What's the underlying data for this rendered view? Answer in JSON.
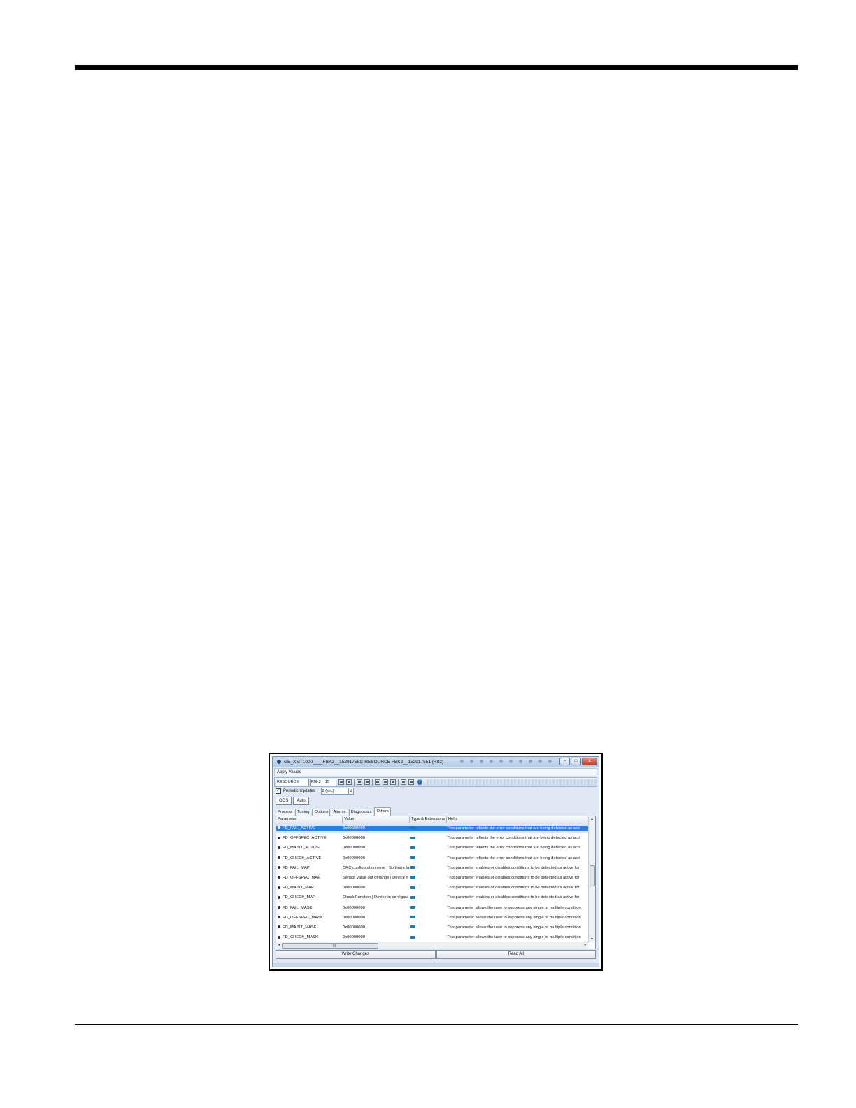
{
  "window": {
    "title": "GE_XMT1000____FBK2__152917551: RESOURCE        FBK2__152917551 (R82)",
    "minimize": "–",
    "maximize": "□",
    "close": "x"
  },
  "menu": {
    "apply_values": "Apply Values"
  },
  "toolbar": {
    "block_name": "RESOURCE",
    "block_tag": "FBK2__15"
  },
  "periodic": {
    "label": "Periodic Updates",
    "checked": "✓",
    "interval": "2 (sec)"
  },
  "modes": [
    "OOS",
    "Auto"
  ],
  "tabs": [
    "Process",
    "Tuning",
    "Options",
    "Alarms",
    "Diagnostics",
    "Others"
  ],
  "active_tab": "Others",
  "table": {
    "headers": [
      "Parameter",
      "Value",
      "Type & Extensions",
      "Help"
    ],
    "rows": [
      {
        "param": "FD_FAIL_ACTIVE",
        "value": "0x00000000",
        "help": "This parameter reflects the error conditions that are being detected as acti"
      },
      {
        "param": "FD_OFFSPEC_ACTIVE",
        "value": "0x00000000",
        "help": "This parameter reflects the error conditions that are being detected as acti"
      },
      {
        "param": "FD_MAINT_ACTIVE",
        "value": "0x00000000",
        "help": "This parameter reflects the error conditions that are being detected as acti"
      },
      {
        "param": "FD_CHECK_ACTIVE",
        "value": "0x00000000",
        "help": "This parameter reflects the error conditions that are being detected as acti"
      },
      {
        "param": "FD_FAIL_MAP",
        "value": "CRC configuration error | Software fa",
        "help": "This parameter enables or disables conditions to be detected as active for"
      },
      {
        "param": "FD_OFFSPEC_MAP",
        "value": "Sensor value out of range | Device n",
        "help": "This parameter enables or disables conditions to be detected as active for"
      },
      {
        "param": "FD_MAINT_MAP",
        "value": "0x00000000",
        "help": "This parameter enables or disables conditions to be detected as active for"
      },
      {
        "param": "FD_CHECK_MAP",
        "value": "Check Function | Device in configura",
        "help": "This parameter enables or disables conditions to be detected as active for"
      },
      {
        "param": "FD_FAIL_MASK",
        "value": "0x00000000",
        "help": "This parameter allows the user to suppress any single or multiple condition"
      },
      {
        "param": "FD_OFFSPEC_MASK",
        "value": "0x00000000",
        "help": "This parameter allows the user to suppress any single or multiple condition"
      },
      {
        "param": "FD_MAINT_MASK",
        "value": "0x00000000",
        "help": "This parameter allows the user to suppress any single or multiple condition"
      },
      {
        "param": "FD_CHECK_MASK",
        "value": "0x00000000",
        "help": "This parameter allows the user to suppress any single or multiple condition"
      }
    ]
  },
  "scroll": {
    "up": "▲",
    "down": "▼",
    "left": "◂",
    "right": "▸",
    "grip": "III"
  },
  "buttons": {
    "write_changes": "Write Changes",
    "read_all": "Read All"
  },
  "icons": [
    "status-dot-icon",
    "toolbar-icon",
    "help-icon",
    "checkbox-icon",
    "type-badge-icon"
  ],
  "colors": {
    "selection": "#2c7fe0",
    "window_frame": "#6f8fb3",
    "badge": "#1f7aa8"
  }
}
